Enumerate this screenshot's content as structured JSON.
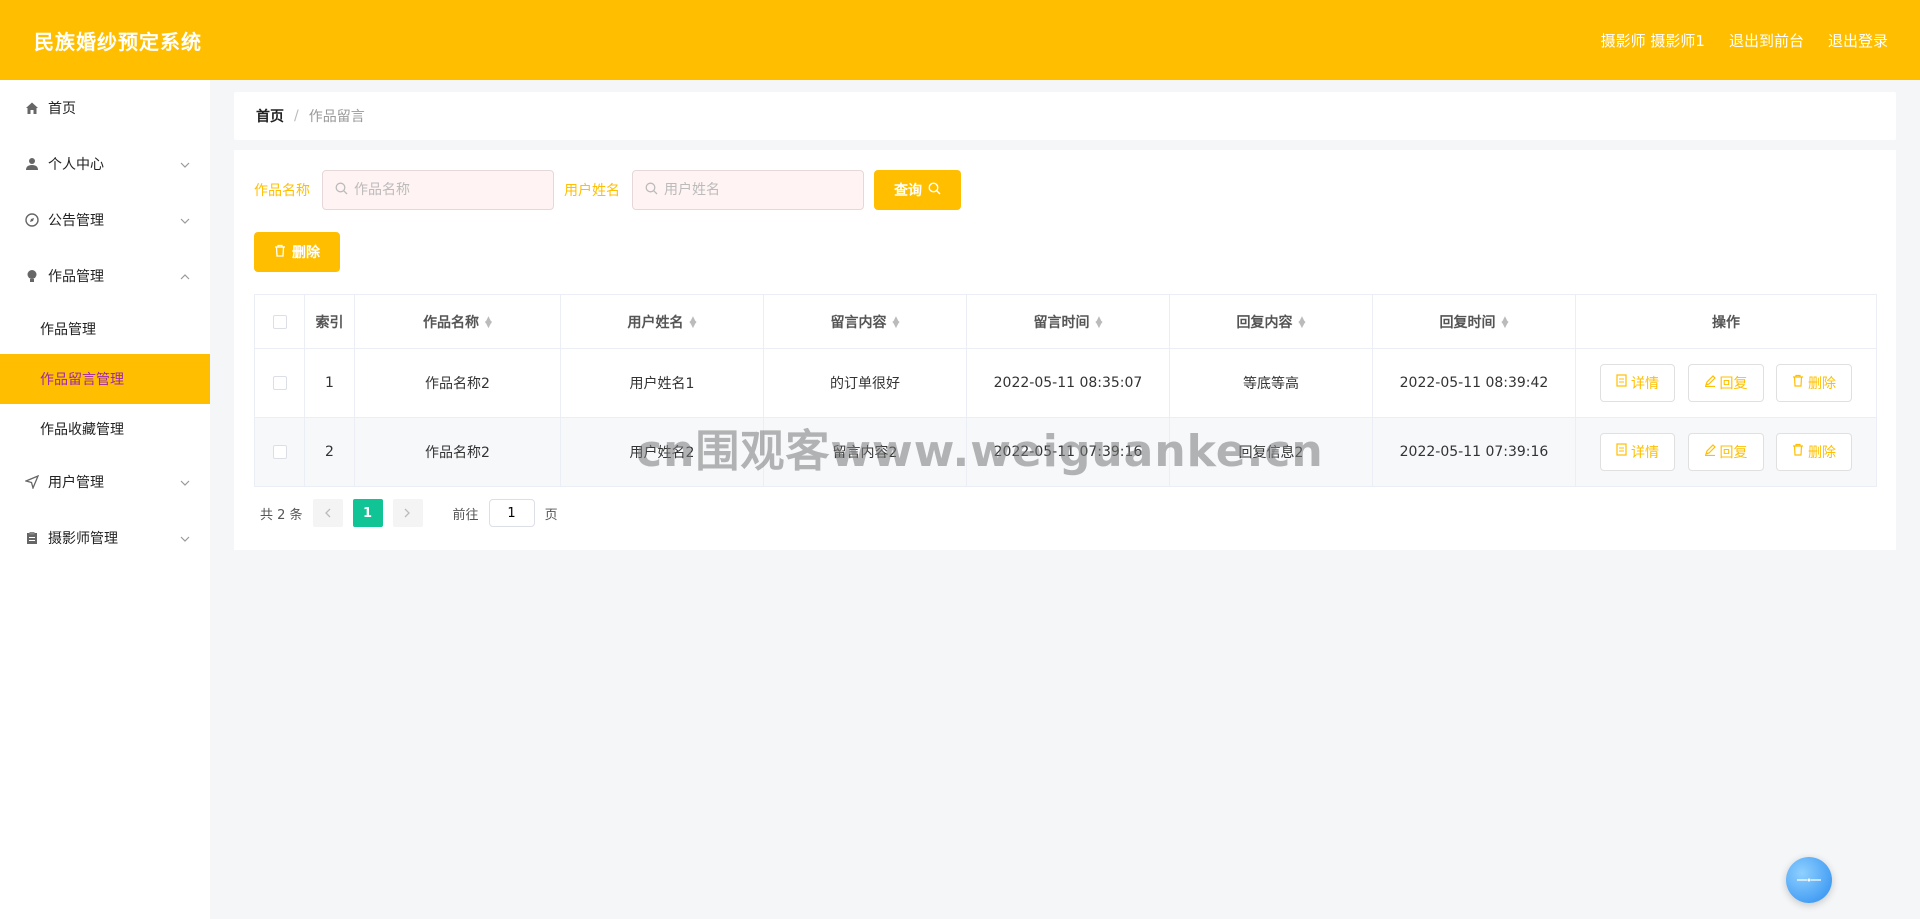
{
  "header": {
    "title": "民族婚纱预定系统",
    "user": "摄影师 摄影师1",
    "to_front": "退出到前台",
    "logout": "退出登录"
  },
  "sidebar": {
    "items": [
      {
        "label": "首页",
        "icon": "home-icon"
      },
      {
        "label": "个人中心",
        "icon": "user-icon"
      },
      {
        "label": "公告管理",
        "icon": "compass-icon"
      },
      {
        "label": "作品管理",
        "icon": "bulb-icon"
      },
      {
        "label": "用户管理",
        "icon": "send-icon"
      },
      {
        "label": "摄影师管理",
        "icon": "clipboard-icon"
      }
    ],
    "sub_items": [
      "作品管理",
      "作品留言管理",
      "作品收藏管理"
    ]
  },
  "breadcrumb": {
    "home": "首页",
    "separator": "/",
    "current": "作品留言"
  },
  "search": {
    "label1": "作品名称",
    "placeholder1": "作品名称",
    "label2": "用户姓名",
    "placeholder2": "用户姓名",
    "button": "查询"
  },
  "actions": {
    "delete": "删除"
  },
  "table": {
    "headers": [
      "索引",
      "作品名称",
      "用户姓名",
      "留言内容",
      "留言时间",
      "回复内容",
      "回复时间",
      "操作"
    ],
    "rows": [
      {
        "index": "1",
        "work": "作品名称2",
        "user": "用户姓名1",
        "content": "的订单很好",
        "time": "2022-05-11 08:35:07",
        "reply": "等底等高",
        "reply_time": "2022-05-11 08:39:42"
      },
      {
        "index": "2",
        "work": "作品名称2",
        "user": "用户姓名2",
        "content": "留言内容2",
        "time": "2022-05-11 07:39:16",
        "reply": "回复信息2",
        "reply_time": "2022-05-11 07:39:16"
      }
    ],
    "ops": {
      "detail": "详情",
      "reply": "回复",
      "delete": "删除"
    }
  },
  "pager": {
    "total": "共 2 条",
    "current_page": "1",
    "goto": "前往",
    "page_value": "1",
    "page_unit": "页"
  },
  "watermark": "cn围观客www.weiguanke.cn",
  "colors": {
    "accent": "#ffbf00",
    "active_text": "#9c27b0",
    "pager_active": "#10c496"
  }
}
